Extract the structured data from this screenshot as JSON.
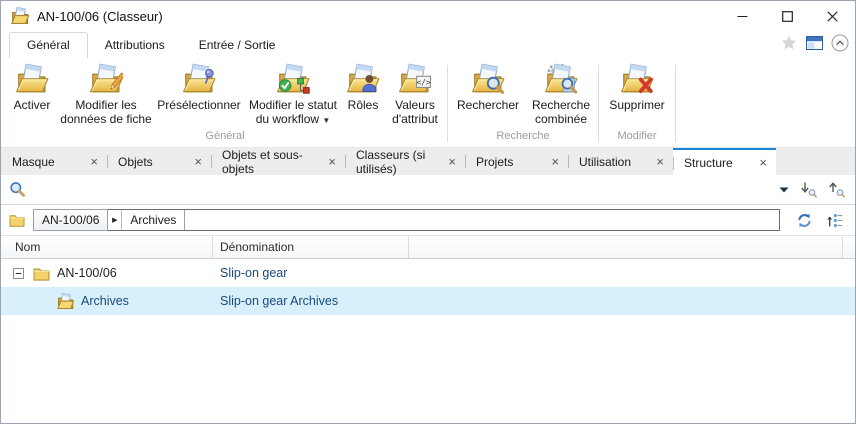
{
  "window": {
    "title": "AN-100/06 (Classeur)"
  },
  "ribbon": {
    "tabs": [
      "Général",
      "Attributions",
      "Entrée / Sortie"
    ],
    "active_tab": "Général",
    "dropdown_caret": "▼",
    "groups": [
      {
        "label": "Général",
        "buttons": [
          "Activer",
          "Modifier les données de fiche",
          "Présélectionner",
          "Modifier le statut du workflow",
          "Rôles",
          "Valeurs d'attribut"
        ]
      },
      {
        "label": "Recherche",
        "buttons": [
          "Rechercher",
          "Recherche combinée"
        ]
      },
      {
        "label": "Modifier",
        "buttons": [
          "Supprimer"
        ]
      }
    ]
  },
  "doc_tabs": {
    "labels": [
      "Masque",
      "Objets",
      "Objets et sous-objets",
      "Classeurs (si utilisés)",
      "Projets",
      "Utilisation",
      "Structure"
    ],
    "active": "Structure",
    "close_glyph": "×"
  },
  "filter": {
    "value": ""
  },
  "breadcrumb": {
    "root": "AN-100/06",
    "arrow": "▶",
    "current": "Archives"
  },
  "table": {
    "columns": [
      "Nom",
      "Dénomination"
    ],
    "rows": [
      {
        "name": "AN-100/06",
        "denomination": "Slip-on gear",
        "level": 0,
        "expanded": true,
        "selected": false
      },
      {
        "name": "Archives",
        "denomination": "Slip-on gear Archives",
        "level": 1,
        "selected": true
      }
    ]
  },
  "colors": {
    "accent_blue": "#1d83d4",
    "link_navy": "#1a4a7c",
    "selected_row": "#d8f0fb",
    "folder_yellow": "#f5d96e"
  }
}
